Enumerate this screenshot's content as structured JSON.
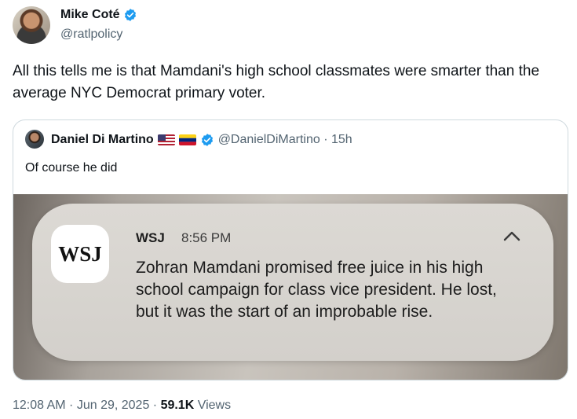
{
  "author": {
    "name": "Mike Coté",
    "handle": "@ratlpolicy",
    "verified_color": "#1d9bf0"
  },
  "tweet": {
    "text": "All this tells me is that Mamdani's high school classmates were smarter than the average NYC Democrat primary voter."
  },
  "quote": {
    "name": "Daniel Di Martino",
    "flags": [
      "us-flag-icon",
      "venezuela-flag-icon"
    ],
    "handle_time": "@DanielDiMartino · 15h",
    "text": "Of course he did",
    "notification": {
      "app_logo": "WSJ",
      "source": "WSJ",
      "time": "8:56 PM",
      "body": "Zohran Mamdani promised free juice in his high school campaign for class vice president. He lost, but it was the start of an improbable rise."
    }
  },
  "footer": {
    "timestamp": "12:08 AM · Jun 29, 2025 · ",
    "views_count": "59.1K",
    "views_label": " Views"
  }
}
